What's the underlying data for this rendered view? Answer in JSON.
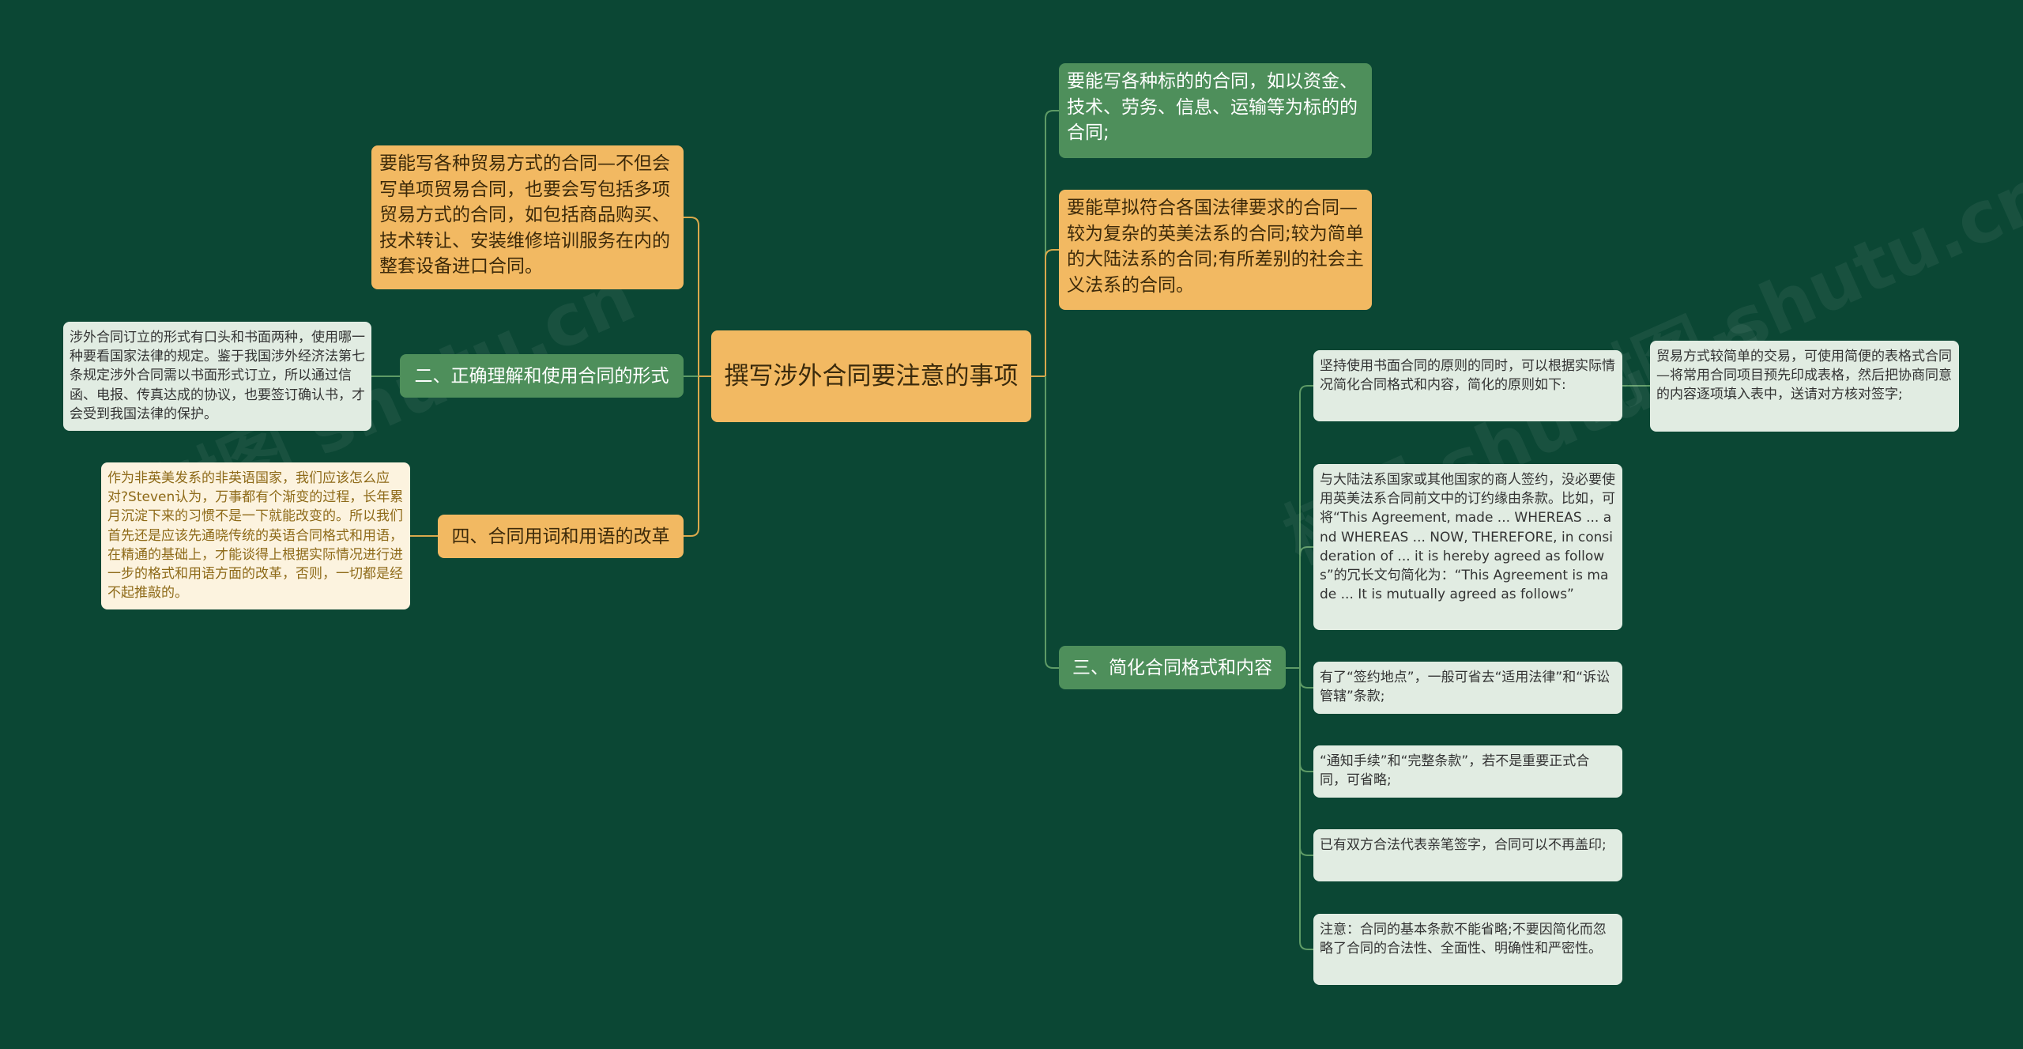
{
  "colors": {
    "background": "#0b4734",
    "root": "#f2b962",
    "orange_node": "#f2b962",
    "green_node": "#4e8f5b",
    "leaf_gray": "#e1ece2",
    "leaf_cream": "#fcf3df",
    "line_orange": "#d9a94c",
    "line_green": "#5e9b66"
  },
  "root": {
    "text": "撰写涉外合同要注意的事项"
  },
  "left": {
    "top_note": {
      "text": "要能写各种贸易方式的合同—不但会写单项贸易合同，也要会写包括多项贸易方式的合同，如包括商品购买、技术转让、安装维修培训服务在内的整套设备进口合同。"
    },
    "branch2": {
      "label": "二、正确理解和使用合同的形式",
      "detail": "涉外合同订立的形式有口头和书面两种，使用哪一种要看国家法律的规定。鉴于我国涉外经济法第七条规定涉外合同需以书面形式订立，所以通过信函、电报、传真达成的协议，也要签订确认书，才会受到我国法律的保护。"
    },
    "branch4": {
      "label": "四、合同用词和用语的改革",
      "detail": "作为非英美发系的非英语国家，我们应该怎么应对?Steven认为，万事都有个渐变的过程，长年累月沉淀下来的习惯不是一下就能改变的。所以我们首先还是应该先通晓传统的英语合同格式和用语，在精通的基础上，才能谈得上根据实际情况进行进一步的格式和用语方面的改革，否则，一切都是经不起推敲的。"
    }
  },
  "right": {
    "note1": {
      "text": "要能写各种标的的合同，如以资金、技术、劳务、信息、运输等为标的的合同;"
    },
    "note2": {
      "text": "要能草拟符合各国法律要求的合同—较为复杂的英美法系的合同;较为简单的大陆法系的合同;有所差别的社会主义法系的合同。"
    },
    "branch3": {
      "label": "三、简化合同格式和内容",
      "items": [
        "坚持使用书面合同的原则的同时，可以根据实际情况简化合同格式和内容，简化的原则如下:",
        "与大陆法系国家或其他国家的商人签约，没必要使用英美法系合同前文中的订约缘由条款。比如，可将“This Agreement, made ... WHEREAS ... and WHEREAS ... NOW, THEREFORE, in consideration of ... it is hereby agreed as follows”的冗长文句简化为：“This Agreement is made ... It is mutually agreed as follows”",
        "有了“签约地点”，一般可省去“适用法律”和“诉讼管辖”条款;",
        "“通知手续”和“完整条款”，若不是重要正式合同，可省略;",
        "已有双方合法代表亲笔签字，合同可以不再盖印;",
        "注意：合同的基本条款不能省略;不要因简化而忽略了合同的合法性、全面性、明确性和严密性。"
      ],
      "sub_detail": "贸易方式较简单的交易，可使用简便的表格式合同—将常用合同项目预先印成表格，然后把协商同意的内容逐项填入表中，送请对方核对签字;"
    }
  },
  "watermarks": [
    "树图 shutu.cn",
    "树图 shutu.cn",
    "树图 shutu.cn"
  ]
}
